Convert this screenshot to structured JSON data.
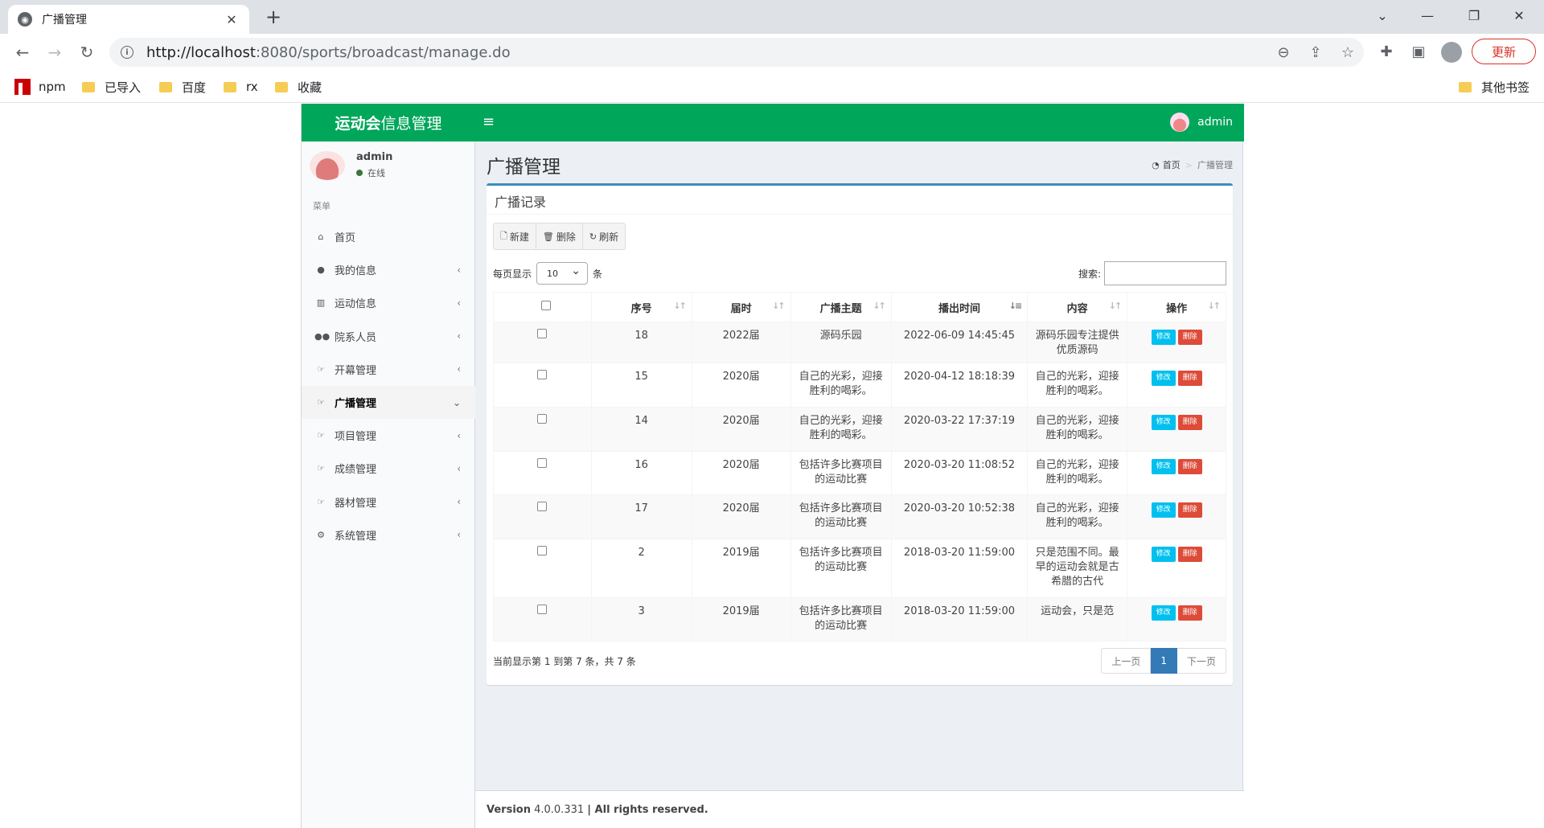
{
  "browser": {
    "tab_title": "广播管理",
    "url_host": "http://localhost",
    "url_rest": ":8080/sports/broadcast/manage.do",
    "update_label": "更新",
    "bookmarks": [
      "npm",
      "已导入",
      "百度",
      "rx",
      "收藏"
    ],
    "other_bookmarks": "其他书签"
  },
  "app": {
    "logo_bold": "运动会",
    "logo_rest": "信息管理",
    "header_user": "admin"
  },
  "sidebar": {
    "user_name": "admin",
    "user_status": "在线",
    "menu_header": "菜单",
    "items": [
      {
        "label": "首页",
        "icon": "home-icon"
      },
      {
        "label": "我的信息",
        "icon": "user-icon"
      },
      {
        "label": "运动信息",
        "icon": "bar-chart-icon"
      },
      {
        "label": "院系人员",
        "icon": "users-icon"
      },
      {
        "label": "开幕管理",
        "icon": "hand-pointer-icon"
      },
      {
        "label": "广播管理",
        "icon": "hand-pointer-icon"
      },
      {
        "label": "项目管理",
        "icon": "hand-pointer-icon"
      },
      {
        "label": "成绩管理",
        "icon": "hand-pointer-icon"
      },
      {
        "label": "器材管理",
        "icon": "hand-pointer-icon"
      },
      {
        "label": "系统管理",
        "icon": "gear-icon"
      }
    ]
  },
  "content": {
    "page_title": "广播管理",
    "breadcrumb_home": "首页",
    "breadcrumb_current": "广播管理",
    "box_title": "广播记录",
    "btn_new": "新建",
    "btn_delete": "删除",
    "btn_refresh": "刷新",
    "length_prefix": "每页显示",
    "length_value": "10",
    "length_suffix": "条",
    "search_label": "搜索:",
    "columns": [
      "序号",
      "届时",
      "广播主题",
      "播出时间",
      "内容",
      "操作"
    ],
    "rows": [
      {
        "id": "18",
        "session": "2022届",
        "topic": "源码乐园",
        "time": "2022-06-09 14:45:45",
        "content": "源码乐园专注提供优质源码"
      },
      {
        "id": "15",
        "session": "2020届",
        "topic": "自己的光彩，迎接胜利的喝彩。",
        "time": "2020-04-12 18:18:39",
        "content": "自己的光彩，迎接胜利的喝彩。"
      },
      {
        "id": "14",
        "session": "2020届",
        "topic": "自己的光彩，迎接胜利的喝彩。",
        "time": "2020-03-22 17:37:19",
        "content": "自己的光彩，迎接胜利的喝彩。"
      },
      {
        "id": "16",
        "session": "2020届",
        "topic": "包括许多比赛项目的运动比赛",
        "time": "2020-03-20 11:08:52",
        "content": "自己的光彩，迎接胜利的喝彩。"
      },
      {
        "id": "17",
        "session": "2020届",
        "topic": "包括许多比赛项目的运动比赛",
        "time": "2020-03-20 10:52:38",
        "content": "自己的光彩，迎接胜利的喝彩。"
      },
      {
        "id": "2",
        "session": "2019届",
        "topic": "包括许多比赛项目的运动比赛",
        "time": "2018-03-20 11:59:00",
        "content": "只是范围不同。最早的运动会就是古希腊的古代"
      },
      {
        "id": "3",
        "session": "2019届",
        "topic": "包括许多比赛项目的运动比赛",
        "time": "2018-03-20 11:59:00",
        "content": "运动会，只是范"
      }
    ],
    "edit_label": "修改",
    "delete_label": "删除",
    "info_text": "当前显示第 1 到第 7 条，共 7 条",
    "prev_label": "上一页",
    "page_current": "1",
    "next_label": "下一页"
  },
  "footer": {
    "version_label": "Version",
    "version": "4.0.0.331",
    "rights": "| All rights reserved."
  }
}
